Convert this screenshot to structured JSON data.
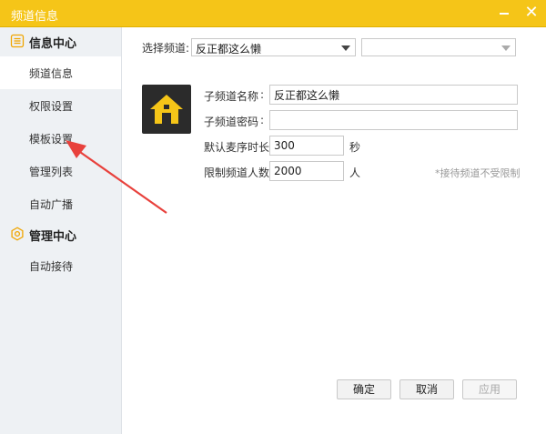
{
  "window": {
    "title": "频道信息"
  },
  "sidebar": {
    "groups": [
      {
        "label": "信息中心",
        "icon": "list-icon",
        "items": [
          {
            "label": "频道信息",
            "active": true
          },
          {
            "label": "权限设置"
          },
          {
            "label": "模板设置"
          },
          {
            "label": "管理列表"
          },
          {
            "label": "自动广播"
          }
        ]
      },
      {
        "label": "管理中心",
        "icon": "gear-icon",
        "items": [
          {
            "label": "自动接待"
          }
        ]
      }
    ]
  },
  "form": {
    "select_channel_label": "选择频道:",
    "channel_select_value": "反正都这么懒",
    "secondary_select_value": "",
    "avatar_icon": "home-icon",
    "subchannel_name_label": "子频道名称",
    "subchannel_name_colon": ":",
    "subchannel_name_value": "反正都这么懒",
    "subchannel_password_label": "子频道密码",
    "subchannel_password_colon": ":",
    "subchannel_password_value": "",
    "mic_duration_label": "默认麦序时长:",
    "mic_duration_value": "300",
    "mic_duration_unit": "秒",
    "user_limit_label": "限制频道人数:",
    "user_limit_value": "2000",
    "user_limit_unit": "人",
    "user_limit_note": "*接待频道不受限制"
  },
  "footer": {
    "ok_label": "确定",
    "cancel_label": "取消",
    "apply_label": "应用"
  },
  "colors": {
    "titlebar": "#f5c518",
    "accent": "#f0a500",
    "arrow": "#e8413c",
    "sidebar_bg": "#eef1f4"
  }
}
